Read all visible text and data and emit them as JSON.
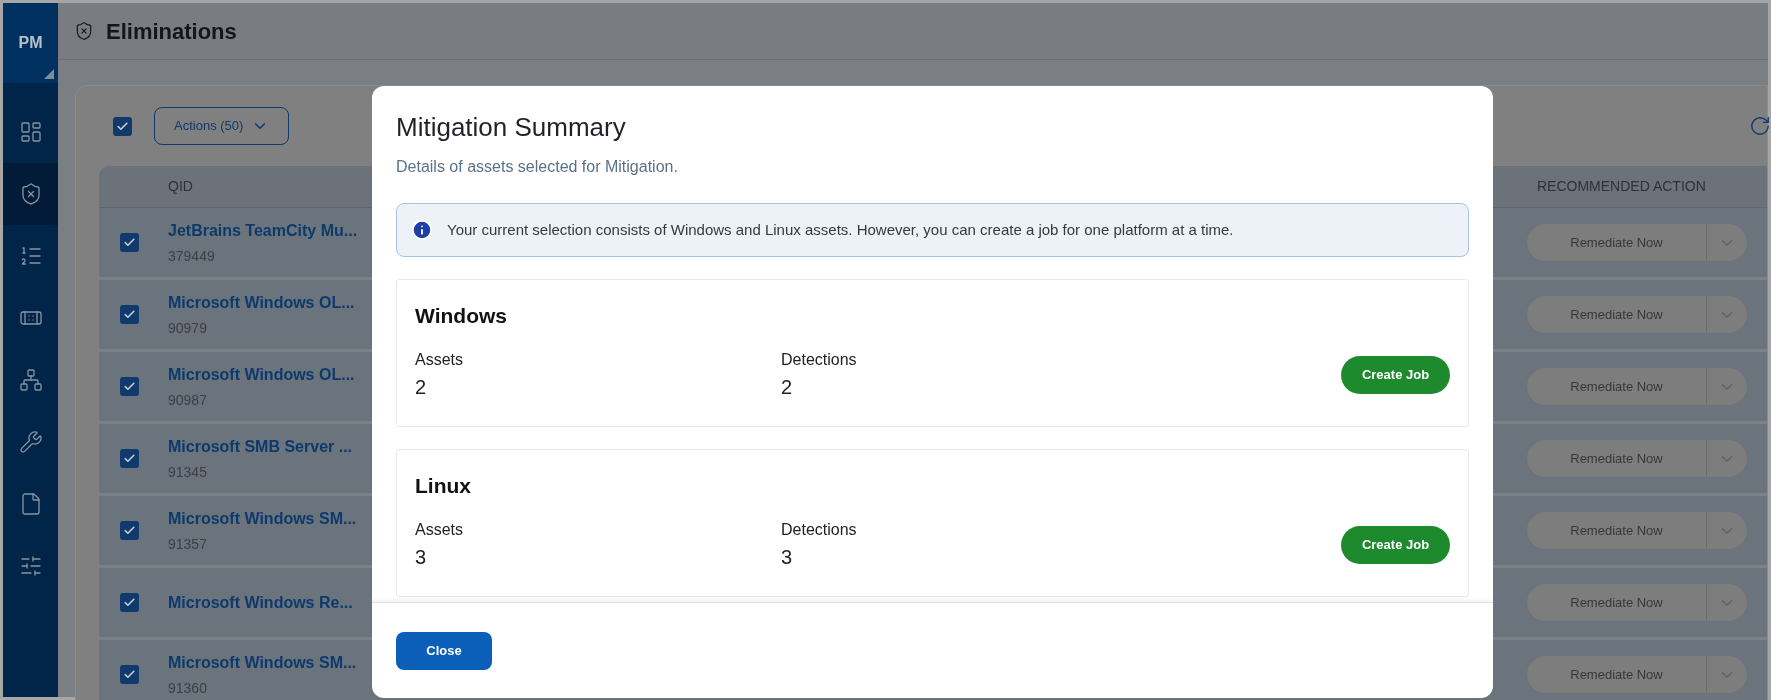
{
  "sidebar": {
    "avatar": "PM",
    "items": [
      {
        "kind": "dashboard",
        "selected": false
      },
      {
        "kind": "shield",
        "selected": true
      },
      {
        "kind": "list",
        "selected": false
      },
      {
        "kind": "patch",
        "selected": false
      },
      {
        "kind": "network",
        "selected": false
      },
      {
        "kind": "tools",
        "selected": false
      },
      {
        "kind": "file",
        "selected": false
      },
      {
        "kind": "sliders",
        "selected": false
      }
    ]
  },
  "header": {
    "title": "Eliminations"
  },
  "toolbar": {
    "select_all_checked": true,
    "actions_label": "Actions (50)"
  },
  "table": {
    "columns": [
      "QID",
      "RECOMMENDED ACTION"
    ],
    "rows": [
      {
        "checked": true,
        "title": "JetBrains TeamCity Mu...",
        "qid": "379449",
        "action": "Remediate Now"
      },
      {
        "checked": true,
        "title": "Microsoft Windows OL...",
        "qid": "90979",
        "action": "Remediate Now"
      },
      {
        "checked": true,
        "title": "Microsoft Windows OL...",
        "qid": "90987",
        "action": "Remediate Now"
      },
      {
        "checked": true,
        "title": "Microsoft SMB Server ...",
        "qid": "91345",
        "action": "Remediate Now"
      },
      {
        "checked": true,
        "title": "Microsoft Windows SM...",
        "qid": "91357",
        "action": "Remediate Now"
      },
      {
        "checked": true,
        "title": "Microsoft Windows Re...",
        "action": "Remediate Now"
      },
      {
        "checked": true,
        "title": "Microsoft Windows SM...",
        "qid": "91360",
        "action": "Remediate Now"
      }
    ]
  },
  "modal": {
    "title": "Mitigation Summary",
    "subtitle": "Details of assets selected for Mitigation.",
    "info": "Your current selection consists of Windows and Linux assets. However, you can create a job for one platform at a time.",
    "platforms": [
      {
        "name": "Windows",
        "assets_label": "Assets",
        "assets": "2",
        "detections_label": "Detections",
        "detections": "2",
        "button": "Create Job"
      },
      {
        "name": "Linux",
        "assets_label": "Assets",
        "assets": "3",
        "detections_label": "Detections",
        "detections": "3",
        "button": "Create Job"
      }
    ],
    "close": "Close"
  }
}
